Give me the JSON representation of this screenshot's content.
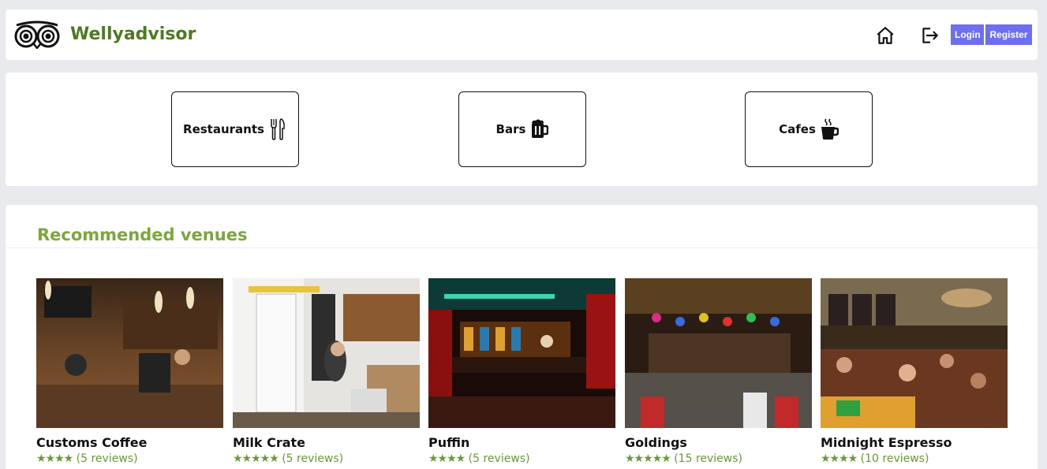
{
  "brand": {
    "name": "Wellyadvisor",
    "color": "#4e7a20",
    "logo_icon": "owl-eyes-icon"
  },
  "nav": {
    "home_icon": "home-icon",
    "logout_icon": "logout-icon",
    "login_label": "Login",
    "register_label": "Register",
    "button_color": "#6e6ef0"
  },
  "categories": [
    {
      "label": "Restaurants",
      "icon": "fork-knife-icon"
    },
    {
      "label": "Bars",
      "icon": "beer-mug-icon"
    },
    {
      "label": "Cafes",
      "icon": "coffee-cup-icon"
    }
  ],
  "recommended": {
    "title": "Recommended venues",
    "title_color": "#7aa83c",
    "venues": [
      {
        "name": "Customs Coffee",
        "stars": "★★★★",
        "reviews": "(5 reviews)"
      },
      {
        "name": "Milk Crate",
        "stars": "★★★★★",
        "reviews": "(5 reviews)"
      },
      {
        "name": "Puffin",
        "stars": "★★★★",
        "reviews": "(5 reviews)"
      },
      {
        "name": "Goldings",
        "stars": "★★★★★",
        "reviews": "(15 reviews)"
      },
      {
        "name": "Midnight Espresso",
        "stars": "★★★★",
        "reviews": "(10 reviews)"
      }
    ]
  }
}
